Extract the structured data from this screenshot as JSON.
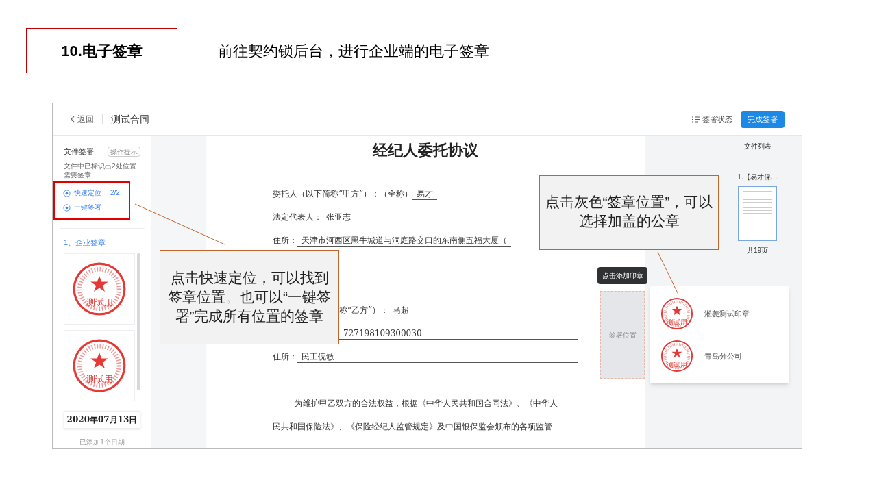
{
  "slide": {
    "title": "10.电子签章",
    "subtitle": "前往契约锁后台，进行企业端的电子签章"
  },
  "header": {
    "back": "返回",
    "doc_title": "测试合同",
    "status": "签署状态",
    "finish_button": "完成签署"
  },
  "sidebar": {
    "title": "文件签署",
    "hint_tag": "操作提示",
    "notice": "文件中已标识出2处位置需要签章",
    "actions": [
      {
        "label": "快速定位",
        "count": "2/2"
      },
      {
        "label": "一键签署"
      }
    ],
    "section": "1、企业签章",
    "seals": [
      {
        "text": "测试用"
      },
      {
        "text": "测试用"
      }
    ],
    "date": "2020年07月13日",
    "date_note": "已添加1个日期"
  },
  "document": {
    "title": "经纪人委托协议",
    "lines": [
      {
        "kind": "full",
        "label": "委托人（以下简称“甲方”）：（全称）",
        "value": "易才",
        "ruled": false
      },
      {
        "kind": "full",
        "label": "法定代表人：",
        "value": "张亚志",
        "ruled": false
      },
      {
        "kind": "full",
        "label": "住所：",
        "value": "天津市河西区黑牛城道与洞庭路交口的东南侧五福大厦（",
        "ruled": false
      },
      {
        "kind": "gap"
      },
      {
        "kind": "covered",
        "label": "称“乙方”）：",
        "value": "马超",
        "ruled": true
      },
      {
        "kind": "covered",
        "value": "727198109300030",
        "ruled": true
      },
      {
        "kind": "full",
        "label": "住所：",
        "value": "民工倪敏",
        "ruled": true
      }
    ],
    "paragraph_lines": [
      "为维护甲乙双方的合法权益，根据《中华人民共和国合同法》、《中华人",
      "民共和国保险法》、《保险经纪人监管规定》及中国银保监会颁布的各项监管"
    ]
  },
  "seal_picker": {
    "tooltip": "点击添加印章",
    "slot": "签署位置",
    "seals": [
      {
        "name": "淞菱测试印章",
        "text": "测试用"
      },
      {
        "name": "青岛分公司",
        "text": "测试用"
      }
    ]
  },
  "file_list": {
    "title": "文件列表",
    "files": [
      {
        "name": "1.【易才保…",
        "pages": "共19页"
      }
    ]
  },
  "callouts": [
    {
      "text": "点击快速定位，可以找到签章位置。也可以“一键签署”完成所有位置的签章"
    },
    {
      "text": "点击灰色“签章位置”，可以选择加盖的公章"
    }
  ]
}
